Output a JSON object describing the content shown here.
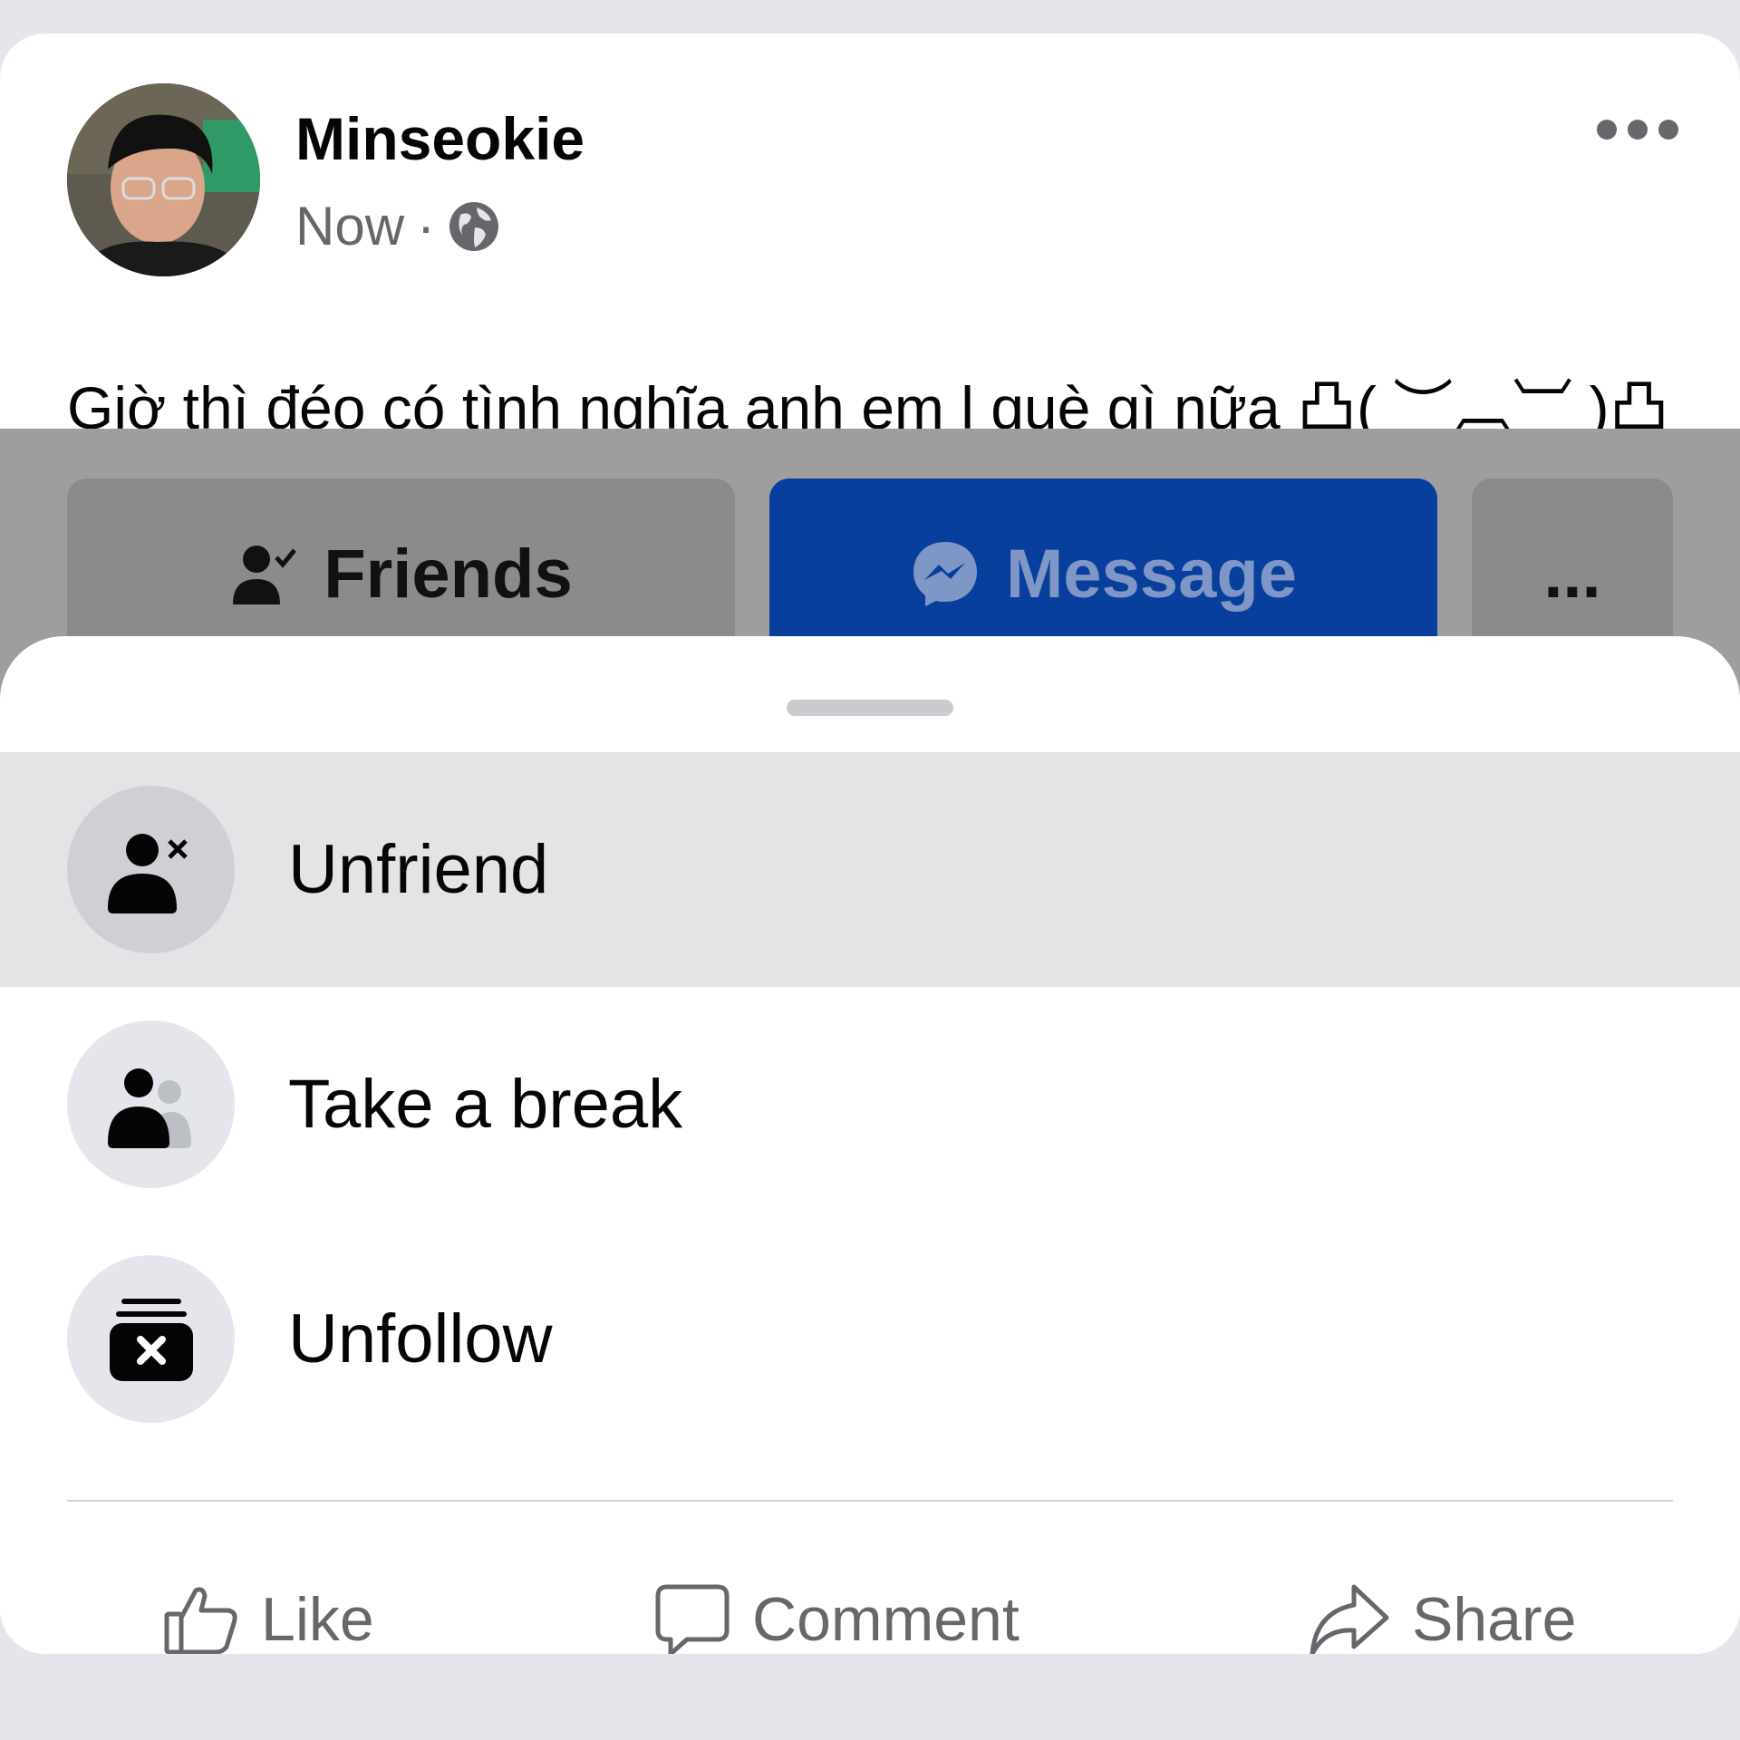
{
  "post": {
    "author": "Minseokie",
    "time": "Now",
    "separator": "·",
    "audience_icon": "globe-icon",
    "text": "Giờ thì đéo có tình nghĩa anh em l què gì nữa 凸( ︶︹︺ )凸",
    "more_icon": "ellipsis-icon"
  },
  "profile_actions": {
    "friends_label": "Friends",
    "message_label": "Message",
    "more_label": "...",
    "message_color": "#083f9c"
  },
  "sheet": {
    "items": [
      {
        "label": "Unfriend",
        "icon": "unfriend-icon"
      },
      {
        "label": "Take a break",
        "icon": "take-a-break-icon"
      },
      {
        "label": "Unfollow",
        "icon": "unfollow-icon"
      }
    ]
  },
  "footer": {
    "like_label": "Like",
    "comment_label": "Comment",
    "share_label": "Share"
  }
}
